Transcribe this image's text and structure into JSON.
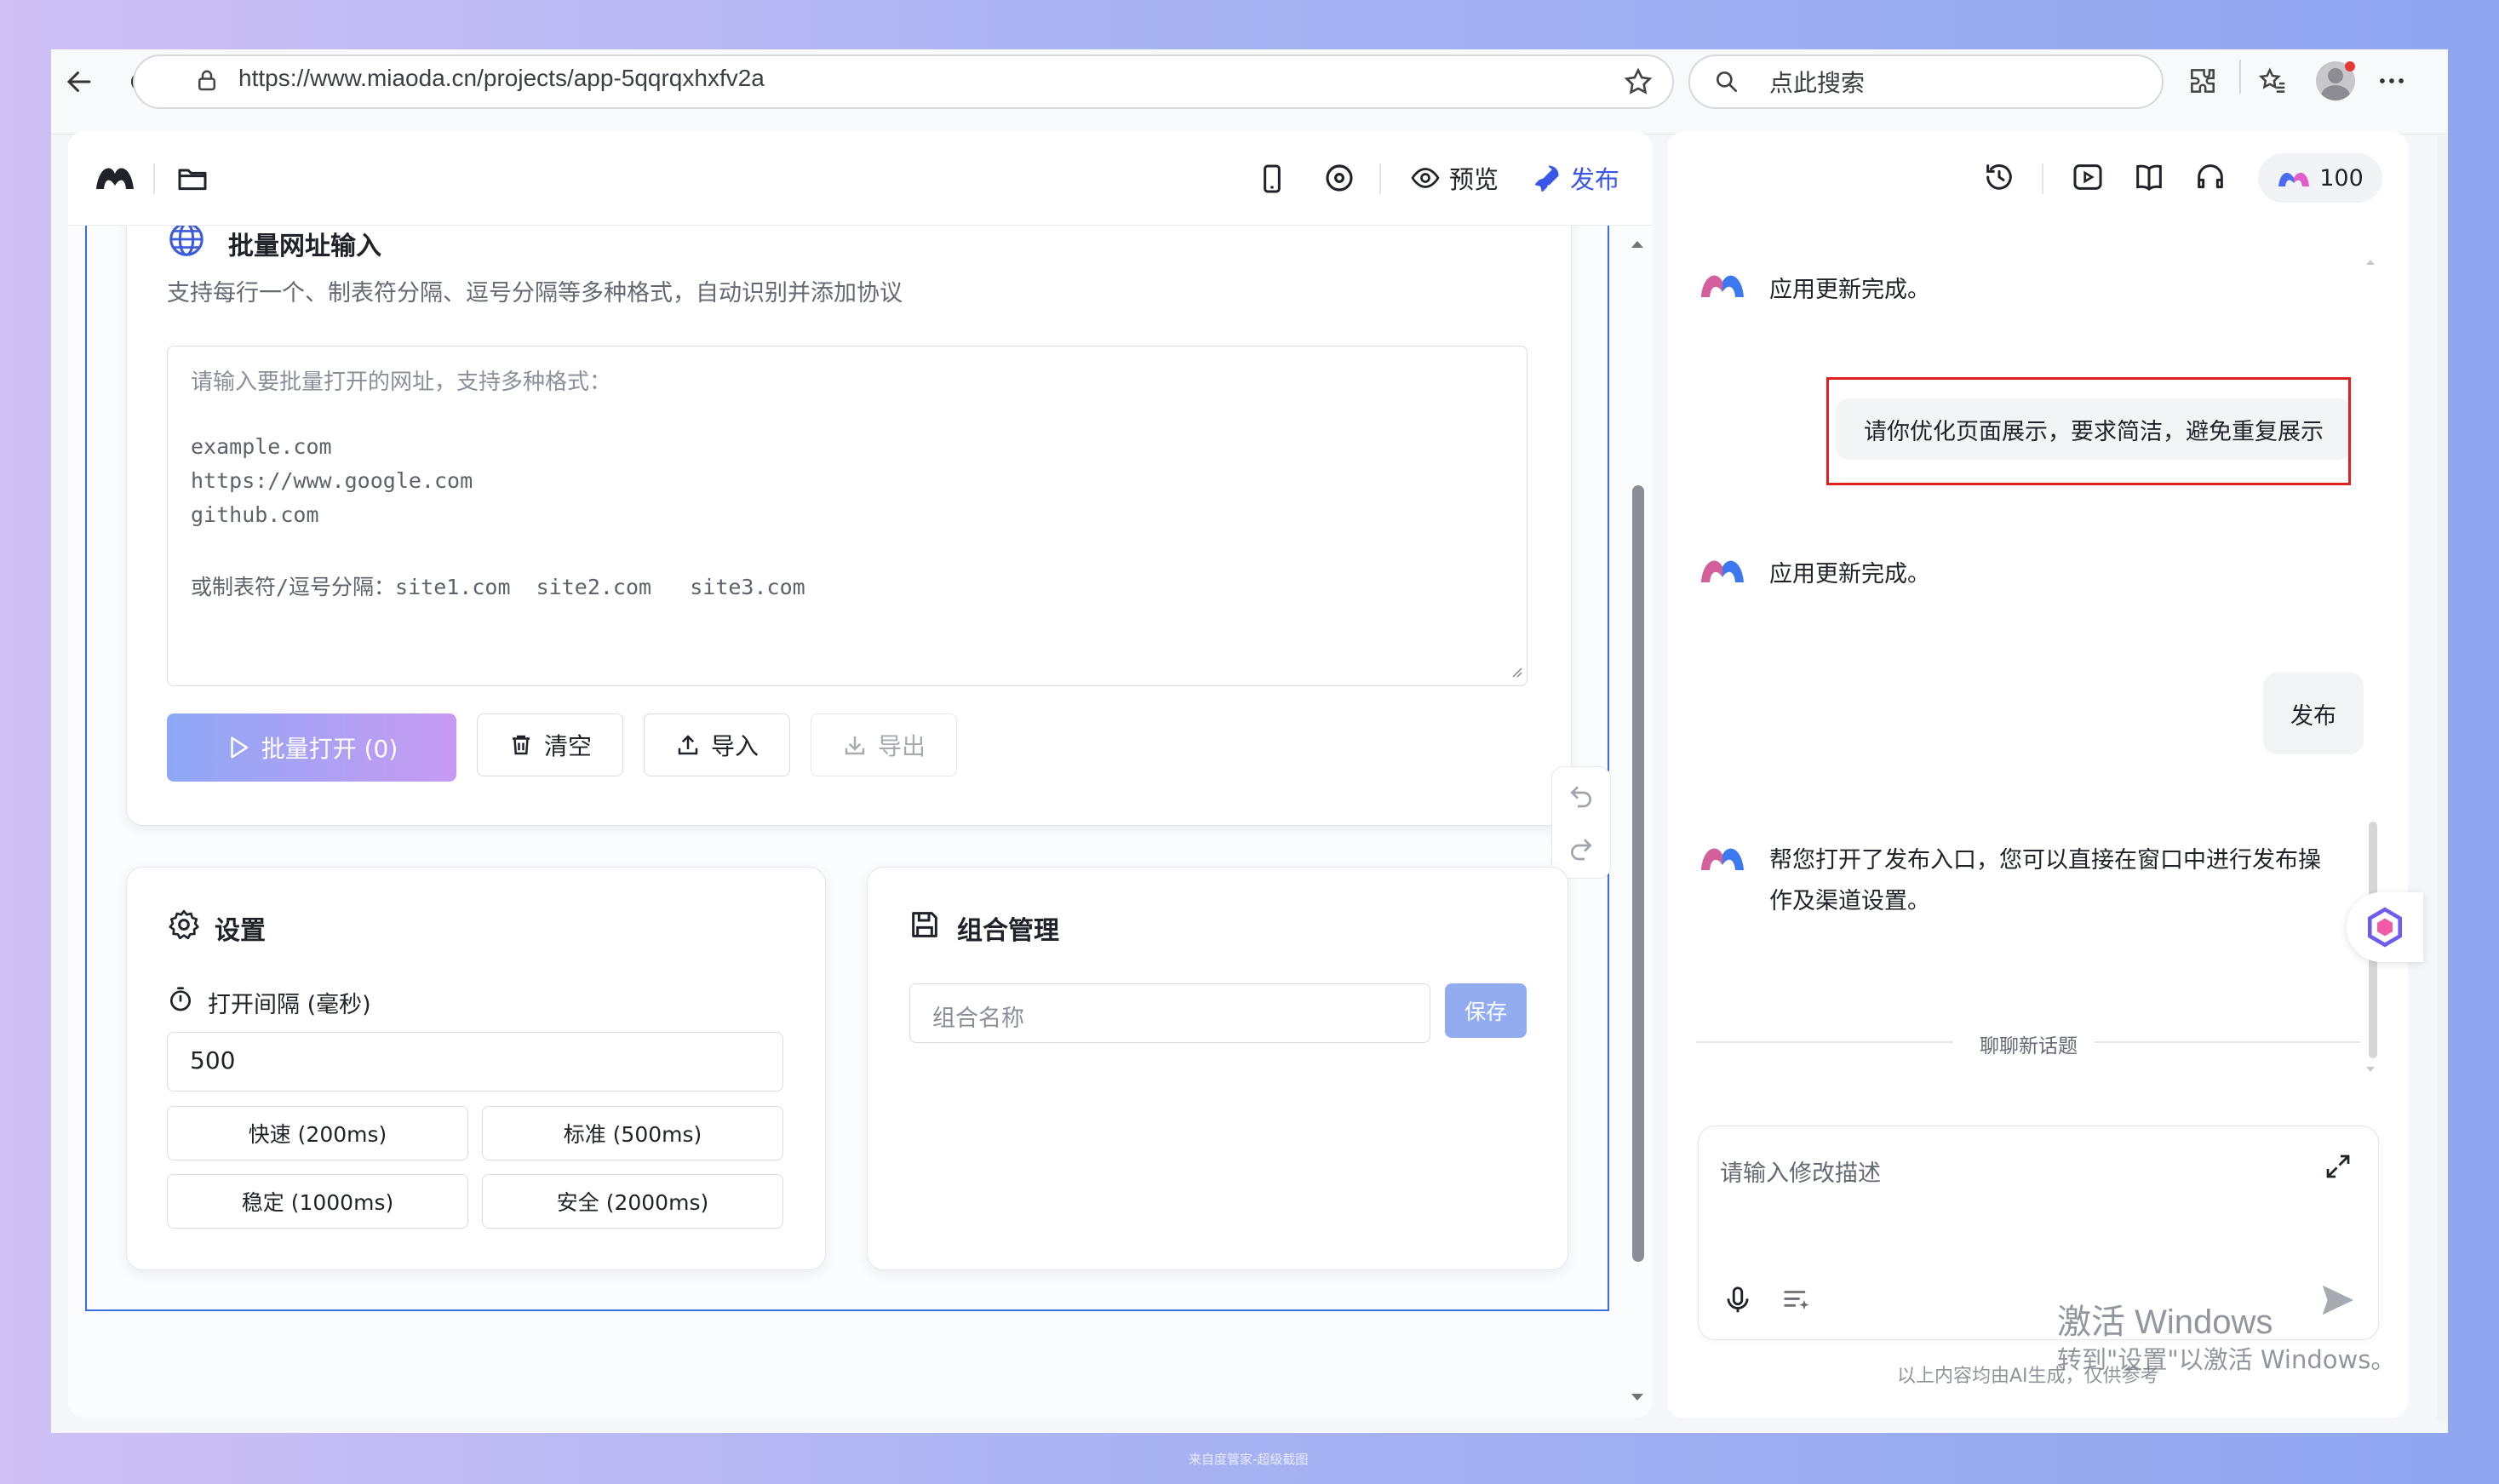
{
  "browser": {
    "url": "https://www.miaoda.cn/projects/app-5qqrqxhxfv2a",
    "search_placeholder": "点此搜索"
  },
  "header": {
    "preview_label": "预览",
    "publish_label": "发布",
    "credits": "100"
  },
  "batch": {
    "title": "批量网址输入",
    "subtitle": "支持每行一个、制表符分隔、逗号分隔等多种格式，自动识别并添加协议",
    "placeholder_lines": [
      "请输入要批量打开的网址，支持多种格式：",
      "",
      "example.com",
      "https://www.google.com",
      "github.com",
      "",
      "或制表符/逗号分隔：site1.com  site2.com   site3.com"
    ],
    "open_button": "批量打开 (0)",
    "clear_button": "清空",
    "import_button": "导入",
    "export_button": "导出"
  },
  "settings": {
    "title": "设置",
    "interval_label": "打开间隔 (毫秒)",
    "interval_value": "500",
    "presets": [
      "快速 (200ms)",
      "标准 (500ms)",
      "稳定 (1000ms)",
      "安全 (2000ms)"
    ]
  },
  "combo": {
    "title": "组合管理",
    "name_placeholder": "组合名称",
    "save_button": "保存"
  },
  "chat": {
    "messages": [
      {
        "role": "assistant",
        "text": "应用更新完成。"
      },
      {
        "role": "user",
        "text": "请你优化页面展示，要求简洁，避免重复展示"
      },
      {
        "role": "assistant",
        "text": "应用更新完成。"
      },
      {
        "role": "user",
        "text": "发布"
      },
      {
        "role": "assistant",
        "lines": [
          "帮您打开了发布入口，您可以直接在窗口中进行发布操",
          "作及渠道设置。"
        ]
      }
    ],
    "new_topic": "聊聊新话题",
    "input_placeholder": "请输入修改描述",
    "disclaimer": "以上内容均由AI生成，仅供参考"
  },
  "watermark": {
    "line1": "激活 Windows",
    "line2": "转到\"设置\"以激活 Windows。"
  },
  "footer_caption": "来自度管家-超级截图",
  "colors": {
    "accent": "#3b5bdb",
    "publish": "#3a56e8",
    "gradient_start": "#8ea8f5",
    "gradient_end": "#c79af2",
    "highlight_box": "#e02020"
  }
}
